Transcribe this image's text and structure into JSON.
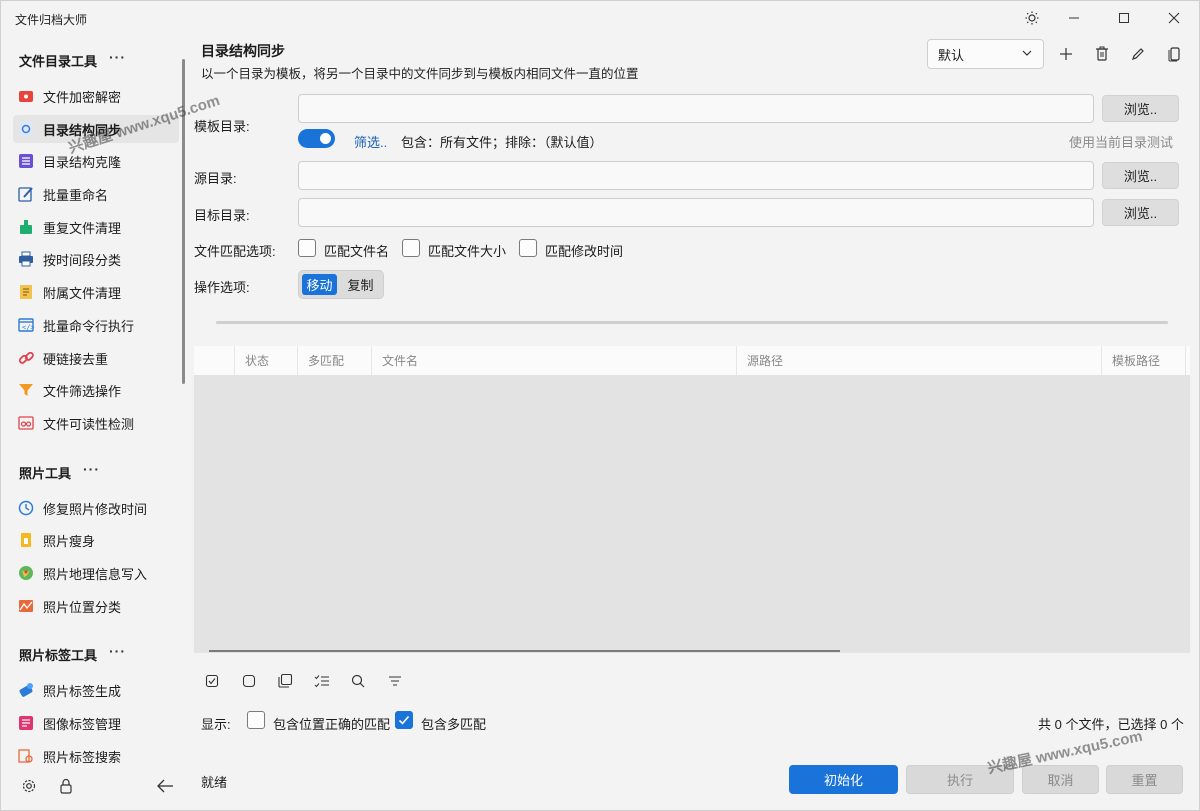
{
  "window": {
    "title": "文件归档大师"
  },
  "sidebar": {
    "groups": [
      {
        "title": "文件目录工具",
        "more": "···"
      },
      {
        "title": "照片工具",
        "more": "···"
      },
      {
        "title": "照片标签工具",
        "more": "···"
      }
    ],
    "items": [
      {
        "label": "文件加密解密",
        "icon": "lock-file-icon"
      },
      {
        "label": "目录结构同步",
        "icon": "sync-icon"
      },
      {
        "label": "目录结构克隆",
        "icon": "list-icon"
      },
      {
        "label": "批量重命名",
        "icon": "rename-icon"
      },
      {
        "label": "重复文件清理",
        "icon": "broom-icon"
      },
      {
        "label": "按时间段分类",
        "icon": "printer-icon"
      },
      {
        "label": "附属文件清理",
        "icon": "document-icon"
      },
      {
        "label": "批量命令行执行",
        "icon": "terminal-icon"
      },
      {
        "label": "硬链接去重",
        "icon": "link-icon"
      },
      {
        "label": "文件筛选操作",
        "icon": "funnel-icon"
      },
      {
        "label": "文件可读性检测",
        "icon": "glasses-icon"
      },
      {
        "label": "修复照片修改时间",
        "icon": "clock-icon"
      },
      {
        "label": "照片瘦身",
        "icon": "photo-file-icon"
      },
      {
        "label": "照片地理信息写入",
        "icon": "globe-icon"
      },
      {
        "label": "照片位置分类",
        "icon": "map-icon"
      },
      {
        "label": "照片标签生成",
        "icon": "ai-tag-icon"
      },
      {
        "label": "图像标签管理",
        "icon": "tag-list-icon"
      },
      {
        "label": "照片标签搜索",
        "icon": "tag-search-icon"
      }
    ]
  },
  "main": {
    "title": "目录结构同步",
    "subtitle": "以一个目录为模板，将另一个目录中的文件同步到与模板内相同文件一直的位置",
    "preset": "默认",
    "template_label": "模板目录:",
    "source_label": "源目录:",
    "target_label": "目标目录:",
    "browse": "浏览..",
    "filter_link": "筛选..",
    "filter_text": "包含：所有文件；排除：（默认值）",
    "test_link": "使用当前目录测试",
    "match_label": "文件匹配选项:",
    "match_name": "匹配文件名",
    "match_size": "匹配文件大小",
    "match_time": "匹配修改时间",
    "op_label": "操作选项:",
    "op_move": "移动",
    "op_copy": "复制",
    "columns": [
      "状态",
      "多匹配",
      "文件名",
      "源路径",
      "模板路径"
    ],
    "show_label": "显示:",
    "show_correct": "包含位置正确的匹配",
    "show_multi": "包含多匹配",
    "count": "共 0 个文件，已选择 0 个",
    "status": "就绪",
    "btn_init": "初始化",
    "btn_exec": "执行",
    "btn_cancel": "取消",
    "btn_reset": "重置"
  },
  "watermarks": [
    "兴趣屋 www.xqu5.com",
    "兴趣屋 www.xqu5.com"
  ],
  "colors": {
    "accent": "#1a73d9"
  }
}
